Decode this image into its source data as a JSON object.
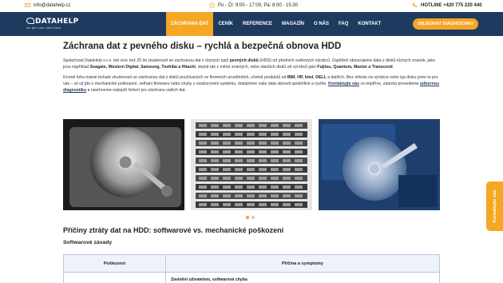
{
  "topbar": {
    "email": "info@datahelp.cz",
    "hours": "Po - Čt: 9:00 - 17:00, Pá: 8:00 - 15:30",
    "hotline": "HOTLINE +420 775 220 440"
  },
  "brand": {
    "name": "DATAHELP",
    "tagline": "we get your data back"
  },
  "nav": {
    "items": [
      "ZÁCHRANA DAT",
      "CENÍK",
      "REFERENCE",
      "MAGAZÍN",
      "O NÁS",
      "FAQ",
      "KONTAKT"
    ],
    "active": 0,
    "cta": "OBJEDNAT DIAGNOSTIKU"
  },
  "page": {
    "title": "Záchrana dat z pevného disku – rychlá a bezpečná obnova HDD",
    "p1": {
      "a": "Společnost DataHelp s.r.o. má více než 25 let zkušeností se záchranou dat z různých typů ",
      "b1": "pevných disků",
      "c": " (HDD) od předních světových výrobců. Úspěšně obnovujeme data z disků různých značek, jako jsou například ",
      "b2": "Seagate, Western Digital, Samsung, Toshiba a Hitachi",
      "d": ", stejně tak z méně známých, nebo starších disků od výrobců jako ",
      "b3": "Fujitsu, Quantum, Maxtor a Transcend",
      "e": "."
    },
    "p2": {
      "a": "Kromě toho máme bohaté zkušenosti se záchranou dat z disků používaných ve firemních prostředích, včetně produktů od ",
      "b1": "IBM, HP, Intel, DELL",
      "c": " a dalších. Bez ohledu na výrobce nebo typ disku jsme tu pro vás – ať už jde o mechanické poškození, selhání firmwaru nebo chyby v souborovém systému, dokážeme vaše data obnovit spolehlivě a rychle. ",
      "link1": "Kontaktujte nás",
      "d": " co nejdříve, zdarma provedeme ",
      "link2": "odbornou diagnostiku",
      "e": " a navrhneme nejlepší řešení pro záchranu vašich dat."
    },
    "carousel": {
      "slides": 3,
      "dots": 2,
      "active_dot": 0
    },
    "h2": "Příčiny ztráty dat na HDD: softwarové vs. mechanické poškození",
    "h3": "Softwarové závady",
    "table": {
      "headers": [
        "Poškození",
        "Příčina a symptomy"
      ],
      "rows": [
        [
          "",
          "Zavinění uživatelem, softwarová chyba"
        ]
      ]
    },
    "side_tab": "Kontaktujte nás"
  },
  "colors": {
    "navy": "#1f3a5f",
    "accent": "#f5a623"
  }
}
